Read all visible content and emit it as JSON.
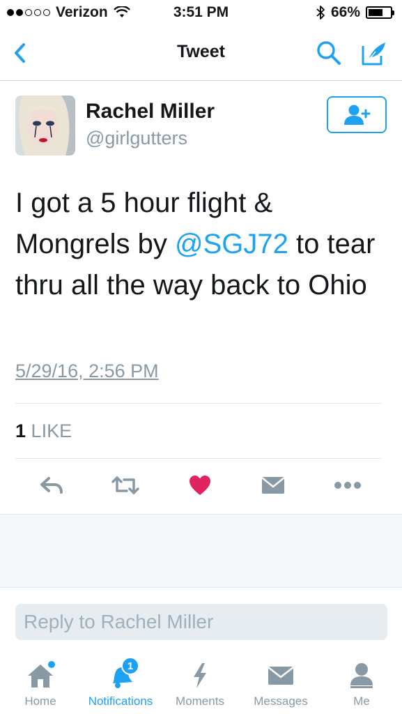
{
  "status_bar": {
    "carrier": "Verizon",
    "time": "3:51 PM",
    "battery": "66%",
    "battery_level": 0.66,
    "signal_bars_filled": 2,
    "signal_bars_total": 5,
    "icons": [
      "wifi-icon",
      "bluetooth-icon",
      "battery-icon"
    ]
  },
  "nav": {
    "title": "Tweet",
    "icons": [
      "back-chevron-icon",
      "search-icon",
      "compose-icon"
    ]
  },
  "tweet": {
    "author_name": "Rachel Miller",
    "author_handle": "@girlgutters",
    "text_before": "I got a 5 hour flight & Mongrels by ",
    "mention": "@SGJ72",
    "text_after": " to tear thru all the way back to Ohio",
    "timestamp": "5/29/16, 2:56 PM",
    "like_count": "1",
    "like_label": "LIKE",
    "liked": true,
    "follow_icon": "follow-user-icon",
    "action_icons": [
      "reply-icon",
      "retweet-icon",
      "heart-icon",
      "direct-message-icon",
      "more-icon"
    ]
  },
  "reply": {
    "placeholder": "Reply to Rachel Miller"
  },
  "tabs": [
    {
      "label": "Home",
      "icon": "home-icon",
      "active": false,
      "badge": "dot"
    },
    {
      "label": "Notifications",
      "icon": "bell-icon",
      "active": true,
      "badge": "1"
    },
    {
      "label": "Moments",
      "icon": "lightning-icon",
      "active": false
    },
    {
      "label": "Messages",
      "icon": "envelope-icon",
      "active": false
    },
    {
      "label": "Me",
      "icon": "person-icon",
      "active": false
    }
  ],
  "colors": {
    "accent": "#1da1f2",
    "muted": "#8899a6",
    "like": "#e0245e",
    "text": "#14171a",
    "bg_gray": "#f5f8fa"
  }
}
